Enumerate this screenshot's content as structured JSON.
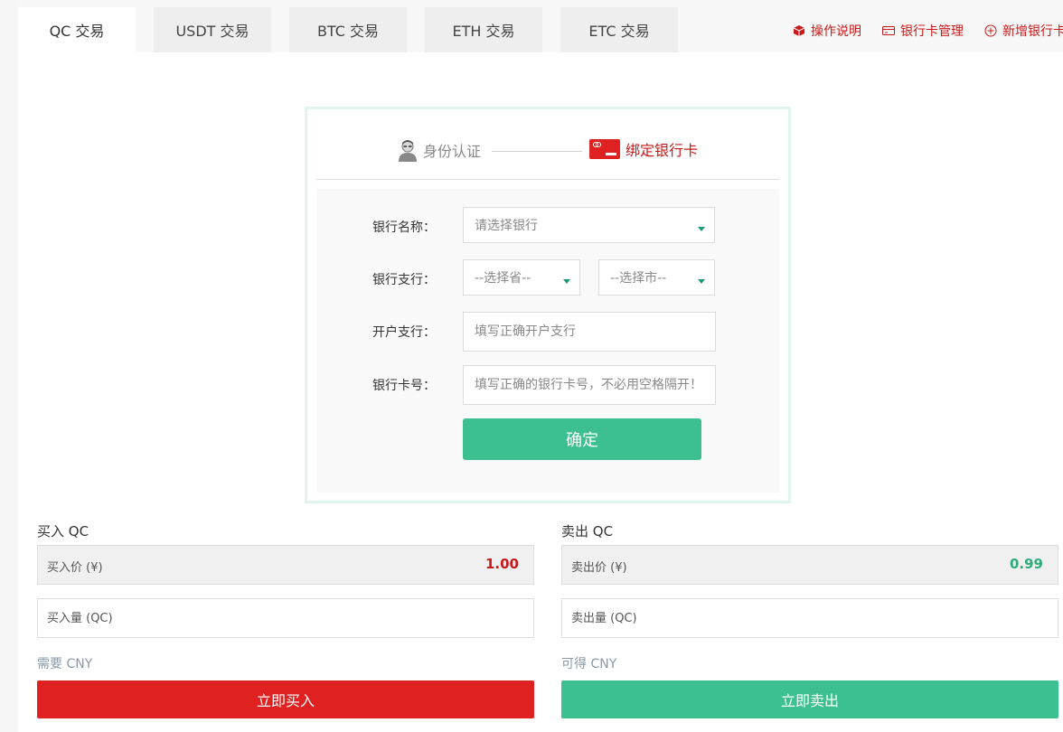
{
  "tabs": [
    {
      "label": "QC 交易",
      "active": true
    },
    {
      "label": "USDT 交易",
      "active": false
    },
    {
      "label": "BTC 交易",
      "active": false
    },
    {
      "label": "ETH 交易",
      "active": false
    },
    {
      "label": "ETC 交易",
      "active": false
    }
  ],
  "top_links": {
    "instructions": "操作说明",
    "bank_card_manage": "银行卡管理",
    "add_bank_card": "新增银行卡"
  },
  "steps": {
    "identity": "身份认证",
    "bind_card": "绑定银行卡"
  },
  "form": {
    "bank_name_label": "银行名称：",
    "bank_name_placeholder": "请选择银行",
    "bank_branch_label": "银行支行：",
    "province_placeholder": "--选择省--",
    "city_placeholder": "--选择市--",
    "open_branch_label": "开户支行：",
    "open_branch_placeholder": "填写正确开户支行",
    "card_number_label": "银行卡号：",
    "card_number_placeholder": "填写正确的银行卡号，不必用空格隔开！",
    "confirm": "确定"
  },
  "buy": {
    "title": "买入 QC",
    "price_label": "买入价 (¥)",
    "price": "1.00",
    "amount_placeholder": "买入量 (QC)",
    "need_note": "需要 CNY",
    "button": "立即买入"
  },
  "sell": {
    "title": "卖出 QC",
    "price_label": "卖出价 (¥)",
    "price": "0.99",
    "amount_placeholder": "卖出量 (QC)",
    "get_note": "可得 CNY",
    "button": "立即卖出"
  },
  "colors": {
    "accent_red": "#c81a1a",
    "buy_red": "#e02121",
    "sell_green": "#3cc08f",
    "price_red": "#c81a1a",
    "price_green": "#2fab7c"
  },
  "icons": {
    "instructions": "cube-icon",
    "bank_card_manage": "card-icon",
    "add_bank_card": "plus-circle-icon",
    "identity": "user-avatar-icon",
    "bind_card": "bank-card-icon"
  }
}
